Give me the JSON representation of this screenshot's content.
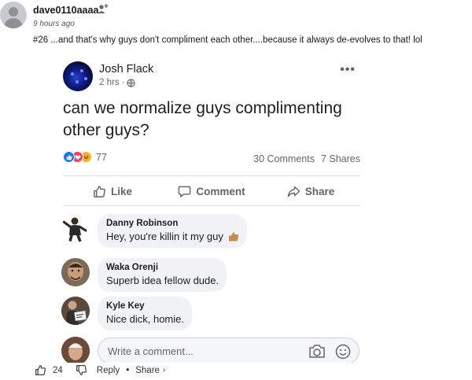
{
  "comment": {
    "username": "dave0110aaaa",
    "time": "9 hours ago",
    "text": "#26 ...and that's why guys don't compliment each other....because it always de-evolves to that! lol"
  },
  "fb_post": {
    "author": "Josh Flack",
    "time": "2 hrs",
    "text": "can we normalize guys complimenting other guys?",
    "reaction_count": "77",
    "comments_count": "30 Comments",
    "shares_count": "7 Shares",
    "actions": {
      "like": "Like",
      "comment": "Comment",
      "share": "Share"
    },
    "comments": [
      {
        "name": "Danny Robinson",
        "text": "Hey, you're killin it my guy"
      },
      {
        "name": "Waka Orenji",
        "text": "Superb idea fellow dude."
      },
      {
        "name": "Kyle Key",
        "text": "Nice dick, homie."
      }
    ],
    "write_placeholder": "Write a comment..."
  },
  "bottom_bar": {
    "upvotes": "24",
    "reply": "Reply",
    "share": "Share"
  },
  "colors": {
    "fb_blue": "#1877f2",
    "love_red": "#f33e58",
    "haha_yellow": "#f7b125",
    "bubble_bg": "#f0f2f5"
  }
}
